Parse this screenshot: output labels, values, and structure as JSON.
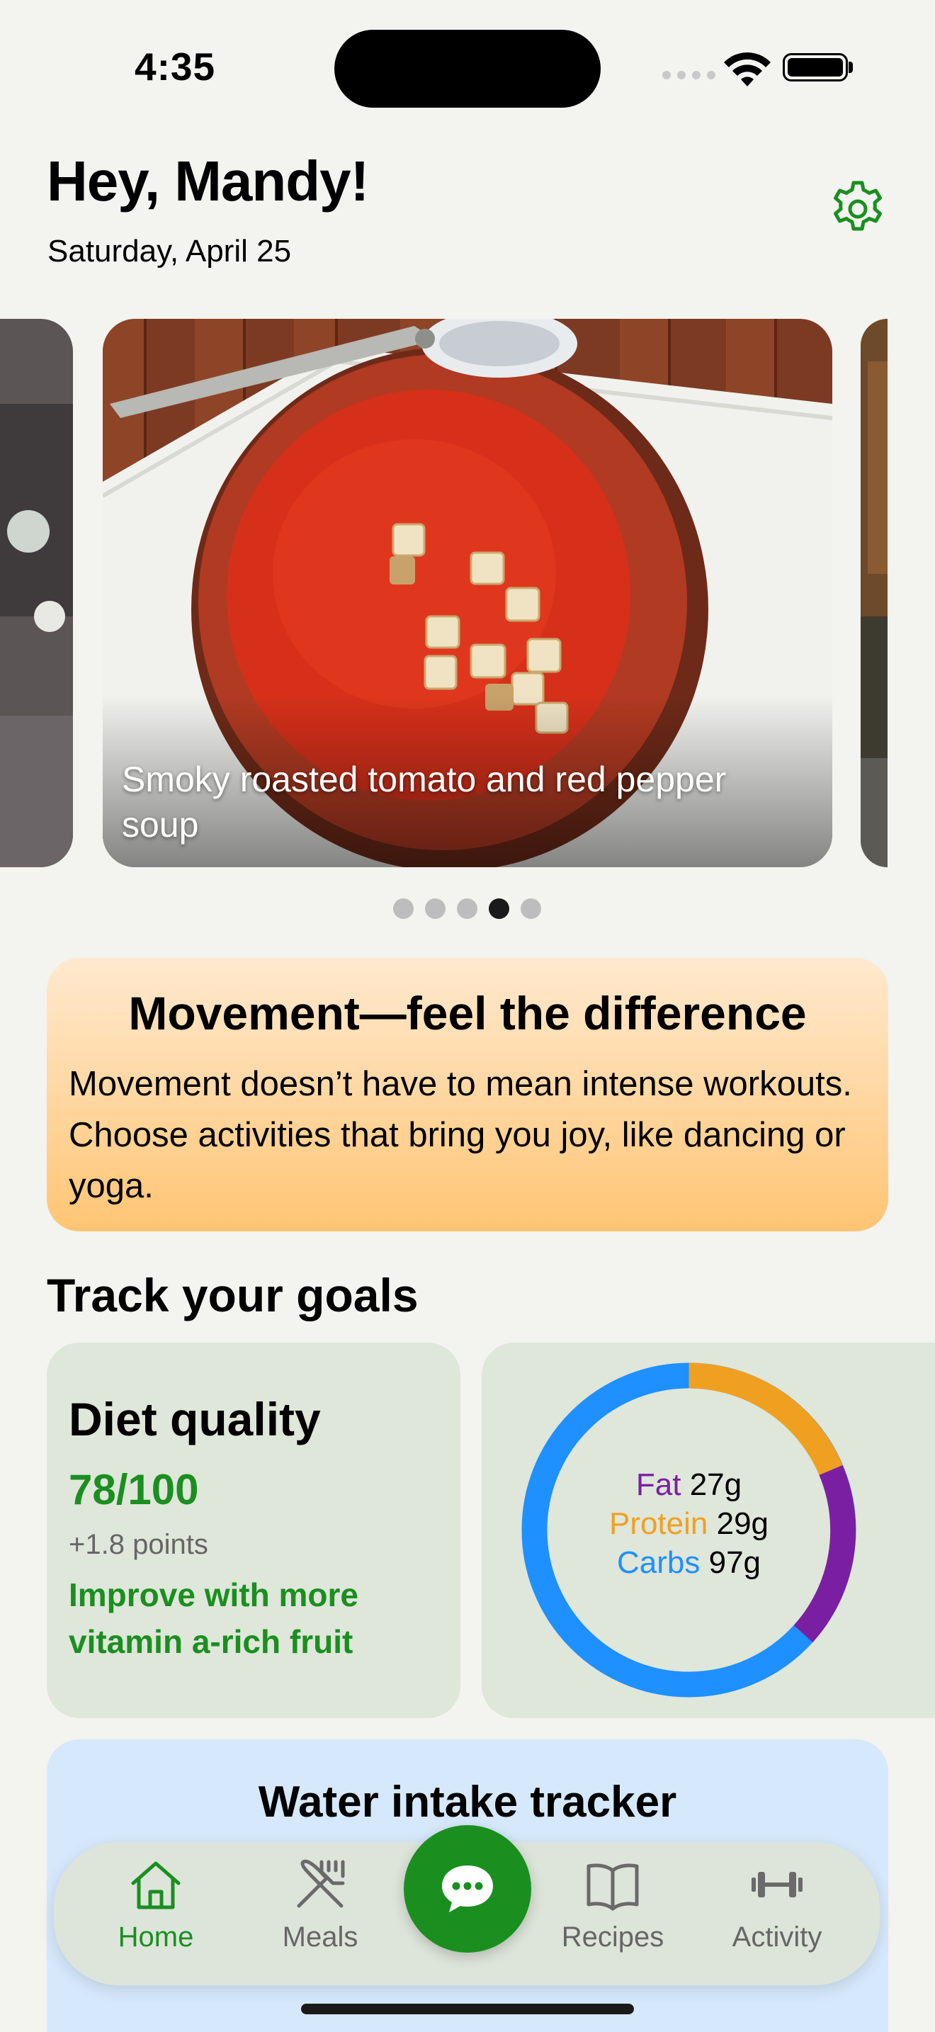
{
  "status_bar": {
    "time": "4:35"
  },
  "header": {
    "greeting": "Hey, Mandy!",
    "date": "Saturday, April 25"
  },
  "carousel": {
    "caption": "Smoky roasted tomato and red pepper soup",
    "page_count": 5,
    "active_index": 3
  },
  "tip": {
    "title": "Movement—feel the difference",
    "body": "Movement doesn’t have to mean intense workouts. Choose activities that bring you joy, like dancing or yoga."
  },
  "goals": {
    "section_title": "Track your goals",
    "diet": {
      "title": "Diet quality",
      "score": "78/100",
      "delta": "+1.8 points",
      "suggestion": "Improve with more vitamin a-rich fruit"
    },
    "macros": {
      "fat_label": "Fat",
      "fat_value": "27g",
      "protein_label": "Protein",
      "protein_value": "29g",
      "carbs_label": "Carbs",
      "carbs_value": "97g",
      "colors": {
        "fat": "#7b1fa2",
        "protein": "#f0a020",
        "carbs": "#1e90ff"
      }
    }
  },
  "water": {
    "title": "Water intake tracker"
  },
  "tabs": [
    {
      "label": "Home",
      "icon": "house-icon",
      "active": true
    },
    {
      "label": "Meals",
      "icon": "fork-knife-icon",
      "active": false
    },
    {
      "label": "Recipes",
      "icon": "book-icon",
      "active": false
    },
    {
      "label": "Activity",
      "icon": "dumbbell-icon",
      "active": false
    }
  ],
  "chat_button": {
    "icon": "chat-bubble-icon"
  },
  "colors": {
    "accent": "#1a8f1f",
    "background": "#f3f3ef"
  }
}
